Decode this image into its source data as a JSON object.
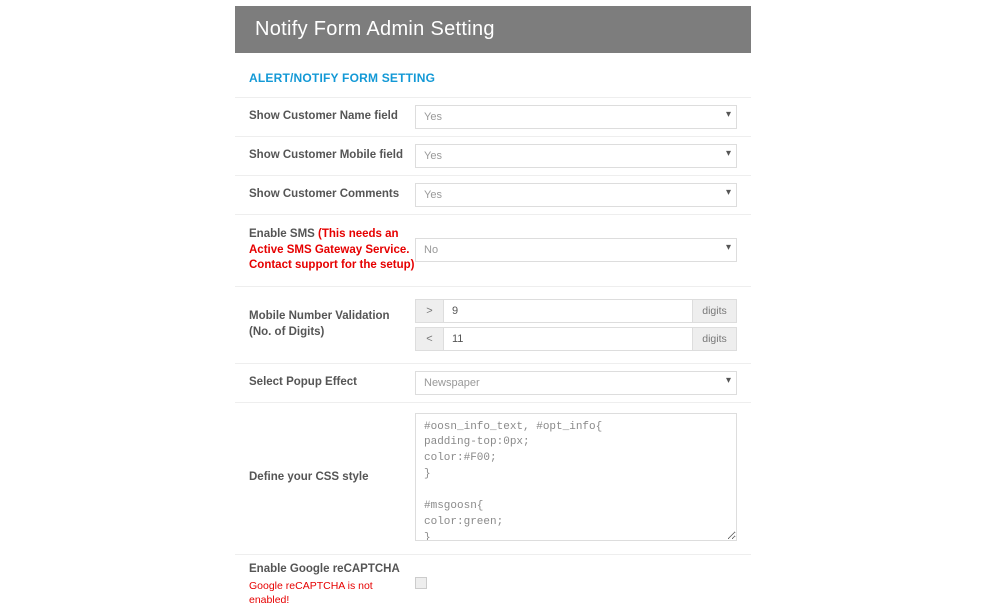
{
  "header": {
    "title": "Notify Form Admin Setting"
  },
  "section": {
    "title": "ALERT/NOTIFY FORM SETTING"
  },
  "fields": {
    "show_name": {
      "label": "Show Customer Name field",
      "value": "Yes"
    },
    "show_mobile": {
      "label": "Show Customer Mobile field",
      "value": "Yes"
    },
    "show_comments": {
      "label": "Show Customer Comments",
      "value": "Yes"
    },
    "enable_sms": {
      "label": "Enable SMS ",
      "warning": "(This needs an Active SMS Gateway Service. Contact support for the setup)",
      "value": "No"
    },
    "mobile_validation": {
      "label": "Mobile Number Validation (No. of Digits)",
      "gt_symbol": ">",
      "gt_value": "9",
      "lt_symbol": "<",
      "lt_value": "11",
      "unit": "digits"
    },
    "popup_effect": {
      "label": "Select Popup Effect",
      "value": "Newspaper"
    },
    "css_style": {
      "label": "Define your CSS style",
      "value": "#oosn_info_text, #opt_info{\npadding-top:0px;\ncolor:#F00;\n}\n\n#msgoosn{\ncolor:green;\n}"
    },
    "recaptcha": {
      "label": "Enable Google reCAPTCHA",
      "warning": "Google reCAPTCHA is not enabled!"
    }
  }
}
